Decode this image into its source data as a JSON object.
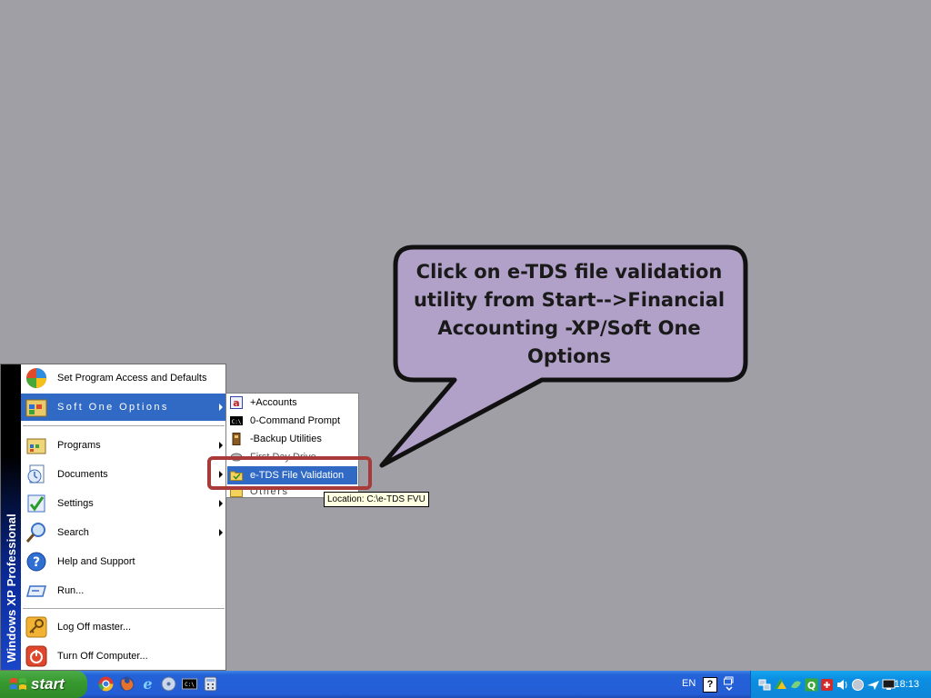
{
  "start_menu": {
    "side_banner": "Windows XP Professional",
    "items": [
      {
        "label": "Set Program Access and Defaults",
        "icon": "program-access-icon"
      },
      {
        "label": "Soft One Options",
        "icon": "soft-one-options-icon"
      },
      {
        "label": "Programs",
        "icon": "programs-icon"
      },
      {
        "label": "Documents",
        "icon": "documents-icon"
      },
      {
        "label": "Settings",
        "icon": "settings-icon"
      },
      {
        "label": "Search",
        "icon": "search-icon"
      },
      {
        "label": "Help and Support",
        "icon": "help-icon"
      },
      {
        "label": "Run...",
        "icon": "run-icon"
      },
      {
        "label": "Log Off master...",
        "icon": "key-icon"
      },
      {
        "label": "Turn Off Computer...",
        "icon": "power-icon"
      }
    ]
  },
  "submenu": {
    "items": [
      {
        "label": "+Accounts",
        "icon": "accounts-icon"
      },
      {
        "label": "0-Command Prompt",
        "icon": "command-prompt-icon"
      },
      {
        "label": "-Backup Utilities",
        "icon": "backup-icon"
      },
      {
        "label": "First Day Drive",
        "icon": "drive-icon"
      },
      {
        "label": "e-TDS File Validation",
        "icon": "folder-icon"
      },
      {
        "label": "Others",
        "icon": "folder-icon"
      }
    ]
  },
  "tooltip": "Location: C:\\e-TDS FVU",
  "callout": {
    "text": "Click on e-TDS file validation utility from Start-->Financial Accounting -XP/Soft One Options"
  },
  "taskbar": {
    "start_label": "start",
    "quick_launch": [
      "chrome-icon",
      "firefox-icon",
      "ie-icon",
      "disk-icon",
      "cmd-icon",
      "calculator-icon"
    ],
    "language": "EN",
    "help_glyph": "?",
    "clock": "18:13"
  },
  "colors": {
    "desktop": "#a19fa6",
    "selection": "#316ac5",
    "callout_fill": "#b1a0c7",
    "highlight_border": "#a83a3a"
  }
}
